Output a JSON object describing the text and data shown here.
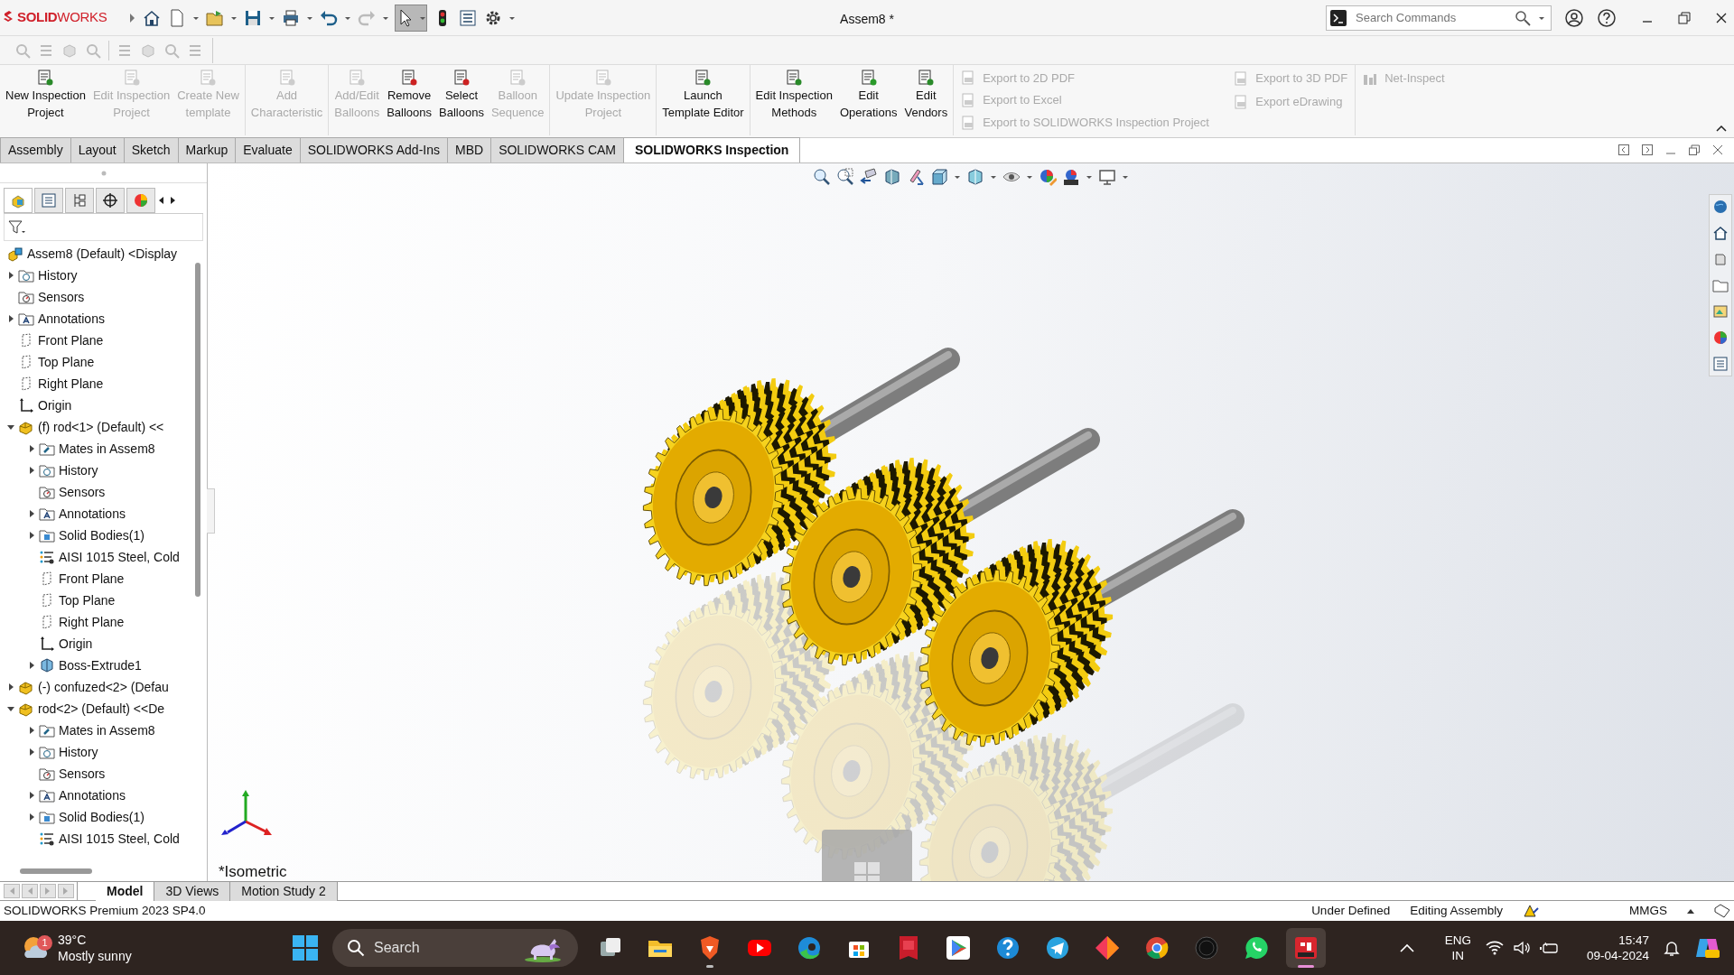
{
  "app": {
    "logo": "**SOLID**WORKS",
    "title": "Assem8 *",
    "select_pressed": true
  },
  "search": {
    "placeholder": "Search Commands"
  },
  "ribbon": {
    "groups": [
      [
        {
          "label": "New Inspection\nProject",
          "disabled": false
        },
        {
          "label": "Edit Inspection\nProject",
          "disabled": true
        },
        {
          "label": "Create New\ntemplate",
          "disabled": true
        }
      ],
      [
        {
          "label": "Add\nCharacteristic",
          "disabled": true
        }
      ],
      [
        {
          "label": "Add/Edit\nBalloons",
          "disabled": true
        },
        {
          "label": "Remove\nBalloons",
          "disabled": false
        },
        {
          "label": "Select\nBalloons",
          "disabled": false
        },
        {
          "label": "Balloon\nSequence",
          "disabled": true
        }
      ],
      [
        {
          "label": "Update Inspection\nProject",
          "disabled": true
        }
      ],
      [
        {
          "label": "Launch\nTemplate Editor",
          "disabled": false
        }
      ],
      [
        {
          "label": "Edit Inspection\nMethods",
          "disabled": false
        },
        {
          "label": "Edit\nOperations",
          "disabled": false
        },
        {
          "label": "Edit\nVendors",
          "disabled": false
        }
      ]
    ],
    "exports": [
      [
        {
          "label": "Export to 2D PDF",
          "disabled": true
        },
        {
          "label": "Export to Excel",
          "disabled": true
        },
        {
          "label": "Export to SOLIDWORKS Inspection Project",
          "disabled": true
        }
      ],
      [
        {
          "label": "Export to 3D PDF",
          "disabled": true
        },
        {
          "label": "Export eDrawing",
          "disabled": true
        }
      ]
    ],
    "net_inspect": {
      "label": "Net-Inspect",
      "disabled": true
    }
  },
  "tabs": [
    {
      "label": "Assembly",
      "selected": false
    },
    {
      "label": "Layout",
      "selected": false
    },
    {
      "label": "Sketch",
      "selected": false
    },
    {
      "label": "Markup",
      "selected": false
    },
    {
      "label": "Evaluate",
      "selected": false
    },
    {
      "label": "SOLIDWORKS Add-Ins",
      "selected": false
    },
    {
      "label": "MBD",
      "selected": false
    },
    {
      "label": "SOLIDWORKS CAM",
      "selected": false
    },
    {
      "label": "SOLIDWORKS Inspection",
      "selected": true
    }
  ],
  "panel_tabs": [
    {
      "selected": true
    },
    {
      "selected": false
    },
    {
      "selected": false
    },
    {
      "selected": false
    },
    {
      "selected": false
    }
  ],
  "tree": [
    {
      "label": "Assem8 (Default) <Display",
      "kind": "assembly",
      "children": [
        {
          "label": "History",
          "kind": "history",
          "expanded": false
        },
        {
          "label": "Sensors",
          "kind": "sensor"
        },
        {
          "label": "Annotations",
          "kind": "annotation",
          "expanded": false
        },
        {
          "label": "Front Plane",
          "kind": "plane"
        },
        {
          "label": "Top Plane",
          "kind": "plane"
        },
        {
          "label": "Right Plane",
          "kind": "plane"
        },
        {
          "label": "Origin",
          "kind": "origin"
        },
        {
          "label": "(f) rod<1> (Default) <<",
          "kind": "part",
          "expanded": true,
          "children": [
            {
              "label": "Mates in Assem8",
              "kind": "mates",
              "expanded": false
            },
            {
              "label": "History",
              "kind": "history",
              "expanded": false
            },
            {
              "label": "Sensors",
              "kind": "sensor"
            },
            {
              "label": "Annotations",
              "kind": "annotation",
              "expanded": false
            },
            {
              "label": "Solid Bodies(1)",
              "kind": "bodies",
              "expanded": false
            },
            {
              "label": "AISI 1015 Steel, Cold",
              "kind": "material"
            },
            {
              "label": "Front Plane",
              "kind": "plane"
            },
            {
              "label": "Top Plane",
              "kind": "plane"
            },
            {
              "label": "Right Plane",
              "kind": "plane"
            },
            {
              "label": "Origin",
              "kind": "origin"
            },
            {
              "label": "Boss-Extrude1",
              "kind": "feature",
              "expanded": false
            }
          ]
        },
        {
          "label": "(-) confuzed<2> (Defau",
          "kind": "part",
          "expanded": false
        },
        {
          "label": "rod<2> (Default) <<De",
          "kind": "part",
          "expanded": true,
          "children": [
            {
              "label": "Mates in Assem8",
              "kind": "mates",
              "expanded": false
            },
            {
              "label": "History",
              "kind": "history",
              "expanded": false
            },
            {
              "label": "Sensors",
              "kind": "sensor"
            },
            {
              "label": "Annotations",
              "kind": "annotation",
              "expanded": false
            },
            {
              "label": "Solid Bodies(1)",
              "kind": "bodies",
              "expanded": false
            },
            {
              "label": "AISI 1015 Steel, Cold",
              "kind": "material"
            }
          ]
        }
      ]
    }
  ],
  "view": {
    "label": "*Isometric"
  },
  "bottom_tabs": [
    {
      "label": "Model",
      "selected": true
    },
    {
      "label": "3D Views",
      "selected": false
    },
    {
      "label": "Motion Study 2",
      "selected": false
    }
  ],
  "status_bar": {
    "product": "SOLIDWORKS Premium 2023 SP4.0",
    "definition": "Under Defined",
    "mode": "Editing Assembly",
    "units": "MMGS"
  },
  "taskbar": {
    "weather": {
      "badge": "1",
      "temperature": "39°C",
      "condition": "Mostly sunny"
    },
    "search": {
      "placeholder": "Search"
    },
    "apps": [
      {
        "kind": "taskview",
        "running": false,
        "active": false
      },
      {
        "kind": "files",
        "running": false,
        "active": false
      },
      {
        "kind": "brave",
        "running": true,
        "active": false
      },
      {
        "kind": "youtube",
        "running": false,
        "active": false
      },
      {
        "kind": "edge",
        "running": false,
        "active": false
      },
      {
        "kind": "store",
        "running": false,
        "active": false
      },
      {
        "kind": "autocad",
        "running": false,
        "active": false
      },
      {
        "kind": "playstore",
        "running": false,
        "active": false
      },
      {
        "kind": "help",
        "running": false,
        "active": false
      },
      {
        "kind": "telegram",
        "running": false,
        "active": false
      },
      {
        "kind": "diamond",
        "running": false,
        "active": false
      },
      {
        "kind": "chrome",
        "running": false,
        "active": false
      },
      {
        "kind": "pw",
        "running": false,
        "active": false
      },
      {
        "kind": "whatsapp",
        "running": false,
        "active": false
      },
      {
        "kind": "solidworks",
        "running": true,
        "active": true
      }
    ],
    "language": "ENG",
    "region": "IN",
    "time": "15:47",
    "date": "09-04-2024"
  }
}
